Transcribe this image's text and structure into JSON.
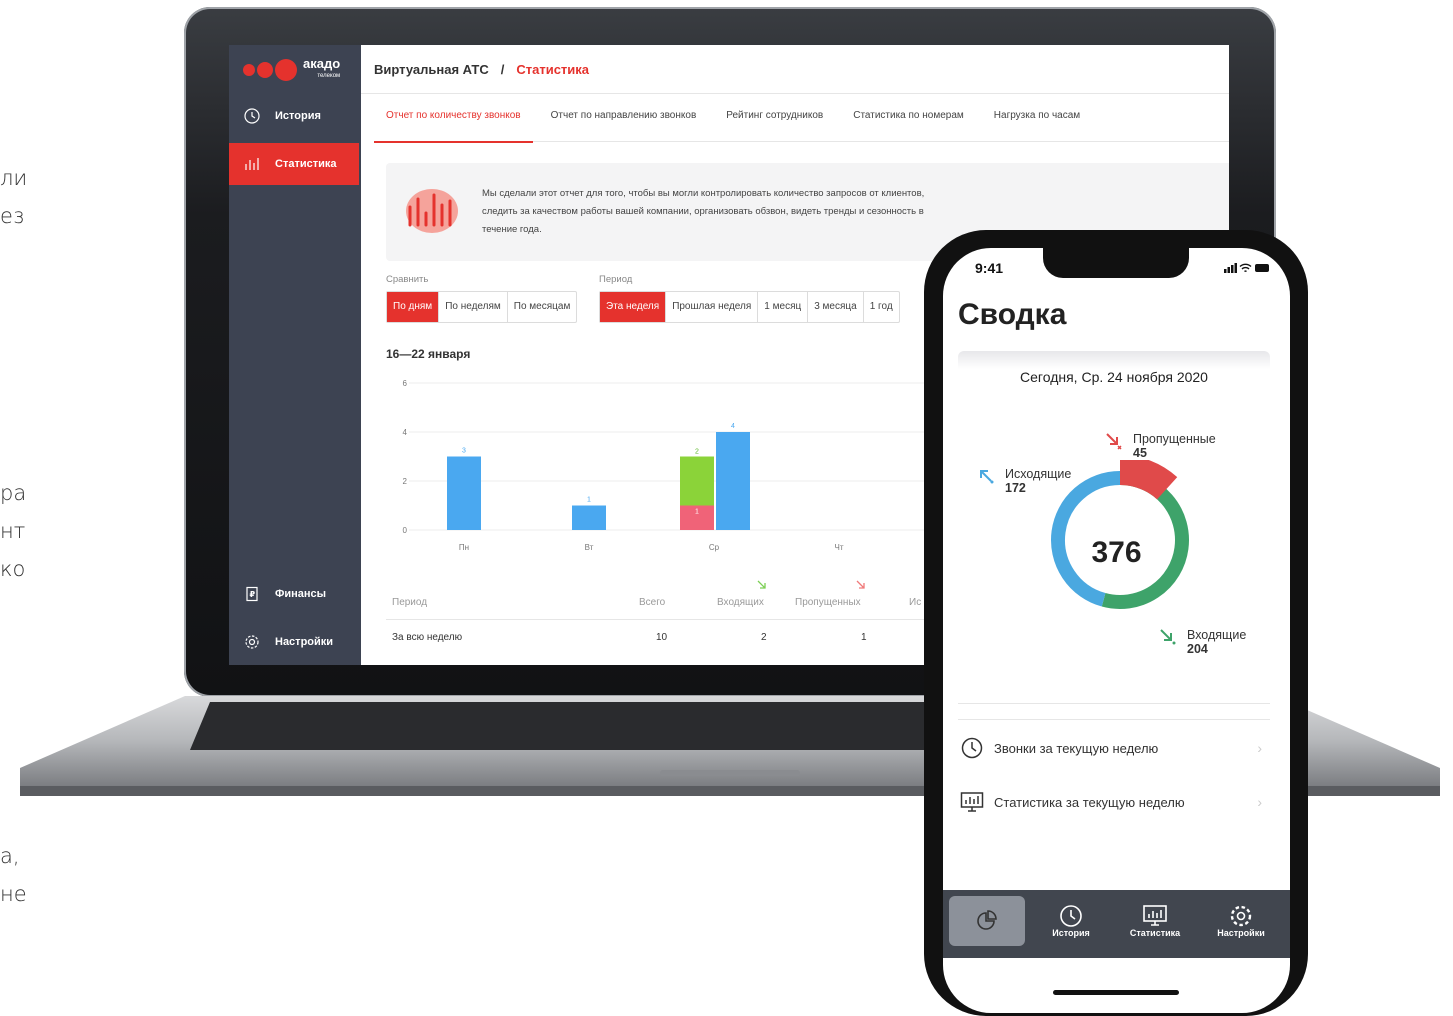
{
  "side_text": [
    "ли",
    "ез",
    "ра",
    "нт",
    "ко",
    "а,",
    "не"
  ],
  "desktop": {
    "logo": {
      "name": "акадо",
      "sub": "телеком"
    },
    "nav": [
      {
        "label": "История",
        "icon": "clock-icon"
      },
      {
        "label": "Статистика",
        "icon": "bar-chart-icon",
        "active": true
      },
      {
        "label": "Финансы",
        "icon": "ruble-document-icon"
      },
      {
        "label": "Настройки",
        "icon": "gear-icon"
      }
    ],
    "breadcrumb": {
      "root": "Виртуальная АТС",
      "separator": "/",
      "current": "Статистика"
    },
    "tabs": [
      "Отчет по количеству звонков",
      "Отчет по направлению звонков",
      "Рейтинг сотрудников",
      "Статистика по номерам",
      "Нагрузка по часам"
    ],
    "info_text": "Мы сделали этот отчет для того, чтобы вы могли контролировать количество запросов от клиентов, следить за качеством работы вашей компании, организовать обзвон, видеть тренды и сезонность в течение года.",
    "compare": {
      "label": "Сравнить",
      "options": [
        "По дням",
        "По неделям",
        "По месяцам"
      ],
      "selected": "По дням"
    },
    "period": {
      "label": "Период",
      "options": [
        "Эта неделя",
        "Прошлая неделя",
        "1 месяц",
        "3 месяца",
        "1 год"
      ],
      "selected": "Эта неделя"
    },
    "range_label": "16—22 января",
    "table": {
      "headers": [
        "Период",
        "Всего",
        "Входящих",
        "Пропущенных",
        "Ис"
      ],
      "row": [
        "За всю неделю",
        "10",
        "2",
        "1"
      ]
    }
  },
  "chart_data": {
    "type": "bar",
    "categories": [
      "Пн",
      "Вт",
      "Ср",
      "Чт"
    ],
    "ylim": [
      0,
      6
    ],
    "yticks": [
      0,
      2,
      4,
      6
    ],
    "series": [
      {
        "color": "#f06378",
        "values": [
          0,
          0,
          1,
          0
        ]
      },
      {
        "color": "#8bd339",
        "values": [
          0,
          0,
          2,
          0
        ]
      },
      {
        "color": "#4aa8f0",
        "values": [
          3,
          1,
          4,
          0
        ]
      }
    ]
  },
  "phone": {
    "time": "9:41",
    "title": "Сводка",
    "date": "Сегодня, Ср. 24 ноября 2020",
    "total": "376",
    "missed": {
      "label": "Пропущенные",
      "value": "45",
      "color": "#e04a4a"
    },
    "outgoing": {
      "label": "Исходящие",
      "value": "172",
      "color": "#4aa8e0"
    },
    "incoming": {
      "label": "Входящие",
      "value": "204",
      "color": "#3ea36a"
    },
    "rows": [
      {
        "label": "Звонки за текущую неделю",
        "icon": "clock-icon"
      },
      {
        "label": "Статистика за текущую неделю",
        "icon": "monitor-chart-icon"
      }
    ],
    "tabbar": [
      {
        "label": "",
        "icon": "pie-chart-icon",
        "active": true
      },
      {
        "label": "История",
        "icon": "clock-icon"
      },
      {
        "label": "Статистика",
        "icon": "monitor-chart-icon"
      },
      {
        "label": "Настройки",
        "icon": "gear-icon"
      }
    ]
  }
}
